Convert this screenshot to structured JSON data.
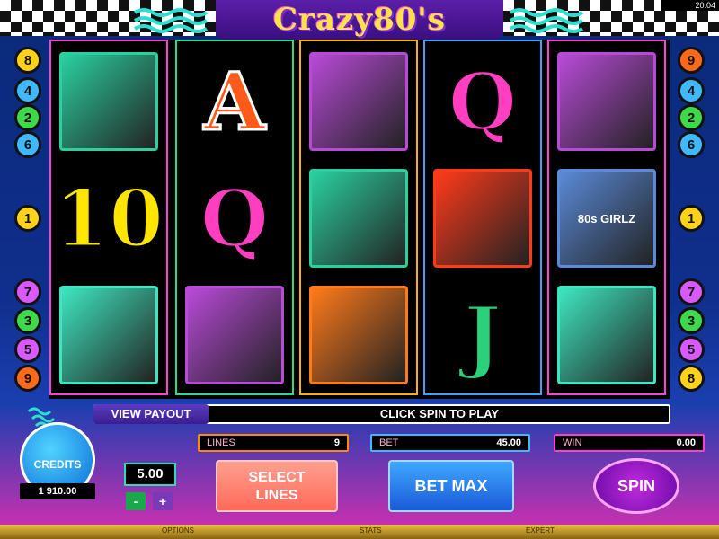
{
  "status": {
    "time": "20:04"
  },
  "title": "Crazy80's",
  "reels": [
    {
      "border": "#ff3fd0",
      "cells": [
        {
          "kind": "icon",
          "name": "sneakers-album-icon",
          "bg": "#2ad0a0",
          "label": ""
        },
        {
          "kind": "letter",
          "text": "10",
          "color": "#ffe500",
          "stroke": "#000"
        },
        {
          "kind": "icon",
          "name": "sunglasses-cube-keys-icon",
          "bg": "#3ee6c0",
          "label": ""
        }
      ]
    },
    {
      "border": "#2adc90",
      "cells": [
        {
          "kind": "letter",
          "text": "A",
          "color": "#ff5a1a",
          "stroke": "#fff"
        },
        {
          "kind": "letter",
          "text": "Q",
          "color": "#ff3fc0",
          "stroke": "#000"
        },
        {
          "kind": "icon",
          "name": "perfume-necklace-icon",
          "bg": "#b84ad8",
          "label": ""
        }
      ]
    },
    {
      "border": "#ffb000",
      "cells": [
        {
          "kind": "icon",
          "name": "perfume-necklace-icon",
          "bg": "#b84ad8",
          "label": ""
        },
        {
          "kind": "icon",
          "name": "sneakers-album-icon",
          "bg": "#2ad0a0",
          "label": ""
        },
        {
          "kind": "icon",
          "name": "boombox-icon",
          "bg": "#ff7a1a",
          "label": ""
        }
      ]
    },
    {
      "border": "#3fa0ff",
      "cells": [
        {
          "kind": "letter",
          "text": "Q",
          "color": "#ff3fc0",
          "stroke": "#000"
        },
        {
          "kind": "icon",
          "name": "boombox-icon",
          "bg": "#ff3a1a",
          "label": ""
        },
        {
          "kind": "letter",
          "text": "J",
          "color": "#2ad07a",
          "stroke": "#000"
        }
      ]
    },
    {
      "border": "#ff3fd0",
      "cells": [
        {
          "kind": "icon",
          "name": "perfume-necklace-icon",
          "bg": "#b84ad8",
          "label": ""
        },
        {
          "kind": "icon",
          "name": "phone-magazine-icon",
          "bg": "#5a8ad8",
          "label": "80s GIRLZ"
        },
        {
          "kind": "icon",
          "name": "sunglasses-cube-keys-icon",
          "bg": "#3ee6c0",
          "label": ""
        }
      ]
    }
  ],
  "left_lines": [
    "8",
    "4",
    "2",
    "6",
    "1",
    "7",
    "3",
    "5",
    "9"
  ],
  "right_lines": [
    "9",
    "4",
    "2",
    "6",
    "1",
    "7",
    "3",
    "5",
    "8"
  ],
  "line_colors": [
    "#ffd21a",
    "#3fb8ff",
    "#3fd84a",
    "#3fb8ff",
    "#ffd21a",
    "#d85aff",
    "#3fd84a",
    "#d85aff",
    "#ff6a1a"
  ],
  "right_line_colors": [
    "#ff6a1a",
    "#3fb8ff",
    "#3fd84a",
    "#3fb8ff",
    "#ffd21a",
    "#d85aff",
    "#3fd84a",
    "#d85aff",
    "#ffd21a"
  ],
  "controls": {
    "view_payout": "VIEW PAYOUT",
    "message": "CLICK SPIN TO PLAY",
    "lines_label": "LINES",
    "lines_value": "9",
    "bet_label": "BET",
    "bet_value": "45.00",
    "win_label": "WIN",
    "win_value": "0.00",
    "credits_label": "CREDITS",
    "credits_value": "1 910.00",
    "coin_value": "5.00",
    "minus": "-",
    "plus": "+",
    "select_lines": "SELECT LINES",
    "bet_max": "BET MAX",
    "spin": "SPIN"
  },
  "footer": {
    "options": "OPTIONS",
    "stats": "STATS",
    "expert": "EXPERT"
  }
}
